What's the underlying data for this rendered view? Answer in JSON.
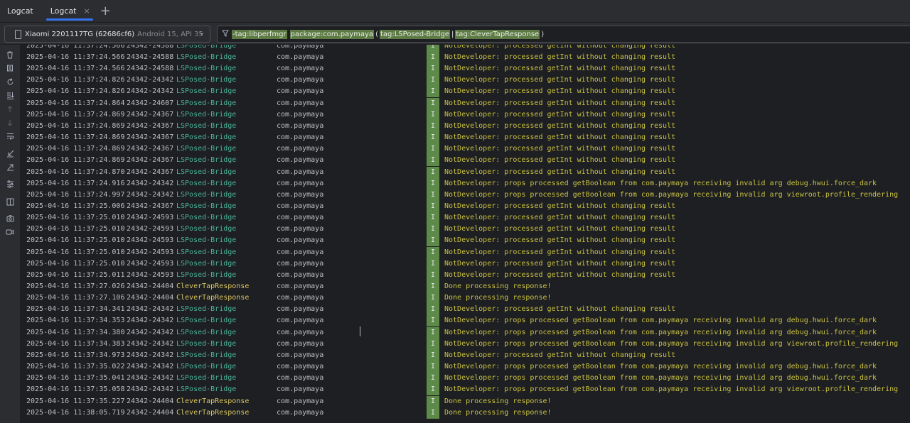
{
  "tabs": {
    "window_title": "Logcat",
    "active_tab": "Logcat",
    "close_glyph": "×",
    "add_glyph": "+"
  },
  "toolbar": {
    "device_name": "Xiaomi 2201117TG (62686cf6)",
    "device_info": "Android 15, API 35",
    "filter_parts": [
      {
        "text": "-tag:libperfmgr",
        "hl": true
      },
      {
        "text": "package:com.paymaya",
        "hl": true
      },
      {
        "text": "(",
        "hl": false
      },
      {
        "text": "tag:LSPosed-Bridge",
        "hl": true
      },
      {
        "text": "|",
        "hl": false
      },
      {
        "text": "tag:CleverTapResponse",
        "hl": true
      },
      {
        "text": ")",
        "hl": false
      }
    ]
  },
  "sidebar_icons": [
    "trash-icon",
    "pause-icon",
    "restart-icon",
    "scroll-to-end-icon",
    "up-arrow-icon",
    "down-arrow-icon",
    "soft-wrap-icon",
    "import-icon",
    "export-icon",
    "settings-icon",
    "split-panels-icon",
    "screenshot-icon",
    "screen-record-icon"
  ],
  "log": {
    "first_row_partial": {
      "timestamp": "2025-04-16 11:37:24.566",
      "pid": "24342-24588",
      "tag": "LSPosed-Bridge",
      "package": "com.paymaya",
      "level": "I",
      "message": "NotDeveloper: processed getInt without changing result"
    },
    "rows": [
      {
        "timestamp": "2025-04-16 11:37:24.566",
        "pid": "24342-24588",
        "tag": "LSPosed-Bridge",
        "package": "com.paymaya",
        "level": "I",
        "message": "NotDeveloper: processed getInt without changing result"
      },
      {
        "timestamp": "2025-04-16 11:37:24.566",
        "pid": "24342-24588",
        "tag": "LSPosed-Bridge",
        "package": "com.paymaya",
        "level": "I",
        "message": "NotDeveloper: processed getInt without changing result"
      },
      {
        "timestamp": "2025-04-16 11:37:24.826",
        "pid": "24342-24342",
        "tag": "LSPosed-Bridge",
        "package": "com.paymaya",
        "level": "I",
        "message": "NotDeveloper: processed getInt without changing result"
      },
      {
        "timestamp": "2025-04-16 11:37:24.826",
        "pid": "24342-24342",
        "tag": "LSPosed-Bridge",
        "package": "com.paymaya",
        "level": "I",
        "message": "NotDeveloper: processed getInt without changing result"
      },
      {
        "timestamp": "2025-04-16 11:37:24.864",
        "pid": "24342-24607",
        "tag": "LSPosed-Bridge",
        "package": "com.paymaya",
        "level": "I",
        "message": "NotDeveloper: processed getInt without changing result"
      },
      {
        "timestamp": "2025-04-16 11:37:24.869",
        "pid": "24342-24367",
        "tag": "LSPosed-Bridge",
        "package": "com.paymaya",
        "level": "I",
        "message": "NotDeveloper: processed getInt without changing result"
      },
      {
        "timestamp": "2025-04-16 11:37:24.869",
        "pid": "24342-24367",
        "tag": "LSPosed-Bridge",
        "package": "com.paymaya",
        "level": "I",
        "message": "NotDeveloper: processed getInt without changing result"
      },
      {
        "timestamp": "2025-04-16 11:37:24.869",
        "pid": "24342-24367",
        "tag": "LSPosed-Bridge",
        "package": "com.paymaya",
        "level": "I",
        "message": "NotDeveloper: processed getInt without changing result"
      },
      {
        "timestamp": "2025-04-16 11:37:24.869",
        "pid": "24342-24367",
        "tag": "LSPosed-Bridge",
        "package": "com.paymaya",
        "level": "I",
        "message": "NotDeveloper: processed getInt without changing result"
      },
      {
        "timestamp": "2025-04-16 11:37:24.869",
        "pid": "24342-24367",
        "tag": "LSPosed-Bridge",
        "package": "com.paymaya",
        "level": "I",
        "message": "NotDeveloper: processed getInt without changing result"
      },
      {
        "timestamp": "2025-04-16 11:37:24.870",
        "pid": "24342-24367",
        "tag": "LSPosed-Bridge",
        "package": "com.paymaya",
        "level": "I",
        "message": "NotDeveloper: processed getInt without changing result"
      },
      {
        "timestamp": "2025-04-16 11:37:24.916",
        "pid": "24342-24342",
        "tag": "LSPosed-Bridge",
        "package": "com.paymaya",
        "level": "I",
        "message": "NotDeveloper: props processed getBoolean from com.paymaya receiving invalid arg debug.hwui.force_dark"
      },
      {
        "timestamp": "2025-04-16 11:37:24.997",
        "pid": "24342-24342",
        "tag": "LSPosed-Bridge",
        "package": "com.paymaya",
        "level": "I",
        "message": "NotDeveloper: props processed getBoolean from com.paymaya receiving invalid arg viewroot.profile_rendering"
      },
      {
        "timestamp": "2025-04-16 11:37:25.006",
        "pid": "24342-24367",
        "tag": "LSPosed-Bridge",
        "package": "com.paymaya",
        "level": "I",
        "message": "NotDeveloper: processed getInt without changing result"
      },
      {
        "timestamp": "2025-04-16 11:37:25.010",
        "pid": "24342-24593",
        "tag": "LSPosed-Bridge",
        "package": "com.paymaya",
        "level": "I",
        "message": "NotDeveloper: processed getInt without changing result"
      },
      {
        "timestamp": "2025-04-16 11:37:25.010",
        "pid": "24342-24593",
        "tag": "LSPosed-Bridge",
        "package": "com.paymaya",
        "level": "I",
        "message": "NotDeveloper: processed getInt without changing result"
      },
      {
        "timestamp": "2025-04-16 11:37:25.010",
        "pid": "24342-24593",
        "tag": "LSPosed-Bridge",
        "package": "com.paymaya",
        "level": "I",
        "message": "NotDeveloper: processed getInt without changing result"
      },
      {
        "timestamp": "2025-04-16 11:37:25.010",
        "pid": "24342-24593",
        "tag": "LSPosed-Bridge",
        "package": "com.paymaya",
        "level": "I",
        "message": "NotDeveloper: processed getInt without changing result"
      },
      {
        "timestamp": "2025-04-16 11:37:25.010",
        "pid": "24342-24593",
        "tag": "LSPosed-Bridge",
        "package": "com.paymaya",
        "level": "I",
        "message": "NotDeveloper: processed getInt without changing result"
      },
      {
        "timestamp": "2025-04-16 11:37:25.011",
        "pid": "24342-24593",
        "tag": "LSPosed-Bridge",
        "package": "com.paymaya",
        "level": "I",
        "message": "NotDeveloper: processed getInt without changing result"
      },
      {
        "timestamp": "2025-04-16 11:37:27.026",
        "pid": "24342-24404",
        "tag": "CleverTapResponse",
        "package": "com.paymaya",
        "level": "I",
        "message": "Done processing response!"
      },
      {
        "timestamp": "2025-04-16 11:37:27.106",
        "pid": "24342-24404",
        "tag": "CleverTapResponse",
        "package": "com.paymaya",
        "level": "I",
        "message": "Done processing response!"
      },
      {
        "timestamp": "2025-04-16 11:37:34.341",
        "pid": "24342-24342",
        "tag": "LSPosed-Bridge",
        "package": "com.paymaya",
        "level": "I",
        "message": "NotDeveloper: processed getInt without changing result"
      },
      {
        "timestamp": "2025-04-16 11:37:34.353",
        "pid": "24342-24342",
        "tag": "LSPosed-Bridge",
        "package": "com.paymaya",
        "level": "I",
        "message": "NotDeveloper: props processed getBoolean from com.paymaya receiving invalid arg debug.hwui.force_dark"
      },
      {
        "timestamp": "2025-04-16 11:37:34.380",
        "pid": "24342-24342",
        "tag": "LSPosed-Bridge",
        "package": "com.paymaya",
        "level": "I",
        "message": "NotDeveloper: props processed getBoolean from com.paymaya receiving invalid arg debug.hwui.force_dark"
      },
      {
        "timestamp": "2025-04-16 11:37:34.383",
        "pid": "24342-24342",
        "tag": "LSPosed-Bridge",
        "package": "com.paymaya",
        "level": "I",
        "message": "NotDeveloper: props processed getBoolean from com.paymaya receiving invalid arg viewroot.profile_rendering"
      },
      {
        "timestamp": "2025-04-16 11:37:34.973",
        "pid": "24342-24342",
        "tag": "LSPosed-Bridge",
        "package": "com.paymaya",
        "level": "I",
        "message": "NotDeveloper: processed getInt without changing result"
      },
      {
        "timestamp": "2025-04-16 11:37:35.022",
        "pid": "24342-24342",
        "tag": "LSPosed-Bridge",
        "package": "com.paymaya",
        "level": "I",
        "message": "NotDeveloper: props processed getBoolean from com.paymaya receiving invalid arg debug.hwui.force_dark"
      },
      {
        "timestamp": "2025-04-16 11:37:35.041",
        "pid": "24342-24342",
        "tag": "LSPosed-Bridge",
        "package": "com.paymaya",
        "level": "I",
        "message": "NotDeveloper: props processed getBoolean from com.paymaya receiving invalid arg debug.hwui.force_dark"
      },
      {
        "timestamp": "2025-04-16 11:37:35.058",
        "pid": "24342-24342",
        "tag": "LSPosed-Bridge",
        "package": "com.paymaya",
        "level": "I",
        "message": "NotDeveloper: props processed getBoolean from com.paymaya receiving invalid arg viewroot.profile_rendering"
      },
      {
        "timestamp": "2025-04-16 11:37:35.227",
        "pid": "24342-24404",
        "tag": "CleverTapResponse",
        "package": "com.paymaya",
        "level": "I",
        "message": "Done processing response!"
      },
      {
        "timestamp": "2025-04-16 11:38:05.719",
        "pid": "24342-24404",
        "tag": "CleverTapResponse",
        "package": "com.paymaya",
        "level": "I",
        "message": "Done processing response!"
      }
    ]
  },
  "colors": {
    "background": "#1e1f22",
    "toolbar": "#2b2d30",
    "tag_lsposed": "#4ab39a",
    "tag_clevertap": "#d8c561",
    "message": "#c9c243",
    "level_badge": "#5d8a48",
    "filter_highlight": "#5d7a45",
    "active_tab_underline": "#3574f0"
  }
}
